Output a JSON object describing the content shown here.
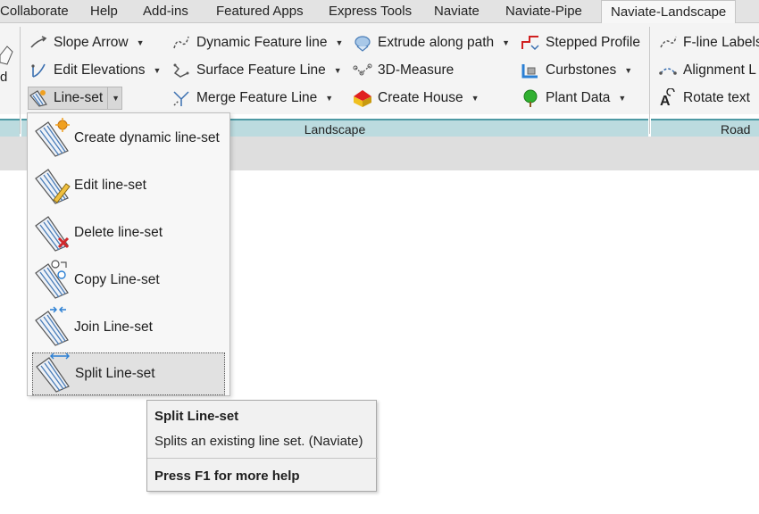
{
  "tabs": [
    "Collaborate",
    "Help",
    "Add-ins",
    "Featured Apps",
    "Express Tools",
    "Naviate",
    "Naviate-Pipe",
    "Naviate-Landscape"
  ],
  "active_tab": "Naviate-Landscape",
  "left_fragment": "d",
  "ribbon": {
    "col1": [
      {
        "label": "Slope Arrow",
        "icon": "slope-arrow-icon"
      },
      {
        "label": "Edit Elevations",
        "icon": "edit-elevations-icon"
      },
      {
        "label": "Line-set",
        "icon": "line-set-icon"
      }
    ],
    "col2": [
      {
        "label": "Dynamic Feature line",
        "icon": "dynamic-feature-line-icon"
      },
      {
        "label": "Surface Feature Line",
        "icon": "surface-feature-line-icon"
      },
      {
        "label": "Merge Feature Line",
        "icon": "merge-feature-line-icon"
      }
    ],
    "col3": [
      {
        "label": "Extrude along path",
        "icon": "extrude-along-path-icon"
      },
      {
        "label": "3D-Measure",
        "icon": "measure-3d-icon"
      },
      {
        "label": "Create House",
        "icon": "create-house-icon"
      }
    ],
    "col4": [
      {
        "label": "Stepped Profile",
        "icon": "stepped-profile-icon"
      },
      {
        "label": "Curbstones",
        "icon": "curbstones-icon"
      },
      {
        "label": "Plant Data",
        "icon": "plant-data-icon"
      }
    ],
    "col5": [
      {
        "label": "F-line Labels",
        "icon": "f-line-labels-icon"
      },
      {
        "label": "Alignment L",
        "icon": "alignment-labels-icon"
      },
      {
        "label": "Rotate text",
        "icon": "rotate-text-icon"
      }
    ],
    "panel_titles": {
      "landscape": "Landscape",
      "road": "Road L"
    }
  },
  "menu": {
    "items": [
      {
        "label": "Create dynamic line-set",
        "icon": "create-dynamic-line-set-icon"
      },
      {
        "label": "Edit line-set",
        "icon": "edit-line-set-icon"
      },
      {
        "label": "Delete line-set",
        "icon": "delete-line-set-icon"
      },
      {
        "label": "Copy Line-set",
        "icon": "copy-line-set-icon"
      },
      {
        "label": "Join Line-set",
        "icon": "join-line-set-icon"
      },
      {
        "label": "Split Line-set",
        "icon": "split-line-set-icon"
      }
    ],
    "hovered": "Split Line-set"
  },
  "tooltip": {
    "title": "Split Line-set",
    "description": "Splits an existing line set. (Naviate)",
    "help": "Press F1 for more help"
  },
  "colors": {
    "accent_teal": "#4e9aa4",
    "panel_title_bg": "#bcdbdf",
    "delete_red": "#d0282a",
    "join_blue": "#2a7fd4"
  }
}
